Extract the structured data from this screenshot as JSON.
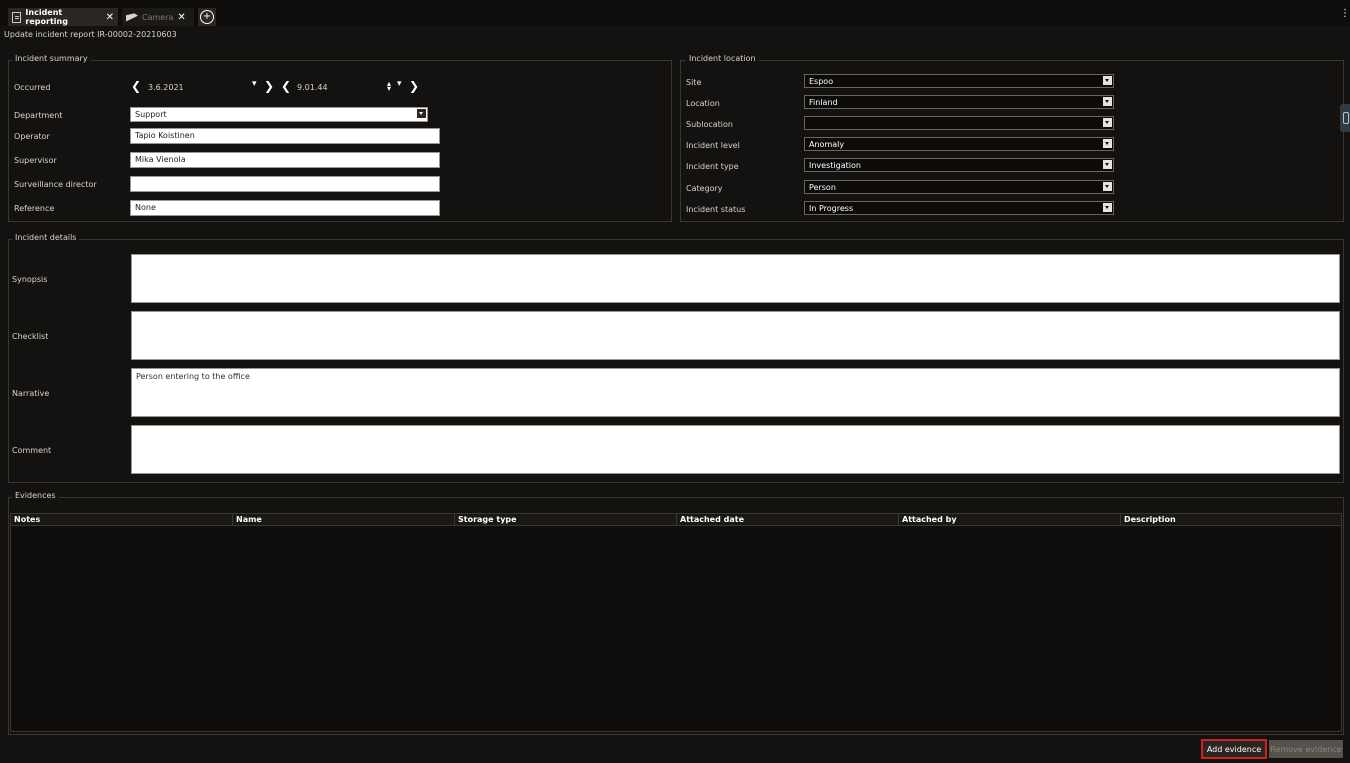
{
  "tabs": [
    {
      "label": "Incident reporting",
      "active": true,
      "icon": "document-icon"
    },
    {
      "label": "Camera",
      "active": false,
      "icon": "camera-icon"
    }
  ],
  "window": {
    "subtitle": "Update incident report IR-00002-20210603"
  },
  "summary": {
    "title": "Incident summary",
    "occurred_label": "Occurred",
    "date": "3.6.2021",
    "time": "9.01.44",
    "department_label": "Department",
    "department": "Support",
    "operator_label": "Operator",
    "operator": "Tapio Koistinen",
    "supervisor_label": "Supervisor",
    "supervisor": "Mika Vienola",
    "surveillance_label": "Surveillance director",
    "surveillance": "",
    "reference_label": "Reference",
    "reference": "None"
  },
  "location": {
    "title": "Incident location",
    "site_label": "Site",
    "site": "Espoo",
    "location_label": "Location",
    "location": "Finland",
    "sublocation_label": "Sublocation",
    "sublocation": "",
    "level_label": "Incident level",
    "level": "Anomaly",
    "type_label": "Incident type",
    "type": "Investigation",
    "category_label": "Category",
    "category": "Person",
    "status_label": "Incident status",
    "status": "In Progress"
  },
  "details": {
    "title": "Incident details",
    "synopsis_label": "Synopsis",
    "synopsis": "",
    "checklist_label": "Checklist",
    "checklist": "",
    "narrative_label": "Narrative",
    "narrative": "Person entering to the office",
    "comment_label": "Comment",
    "comment": ""
  },
  "evidences": {
    "title": "Evidences",
    "columns": [
      "Notes",
      "Name",
      "Storage type",
      "Attached date",
      "Attached by",
      "Description"
    ],
    "rows": []
  },
  "buttons": {
    "add_evidence": "Add evidence",
    "remove_evidence": "Remove evidence"
  },
  "colors": {
    "highlight": "#d02020",
    "background": "#141210"
  }
}
